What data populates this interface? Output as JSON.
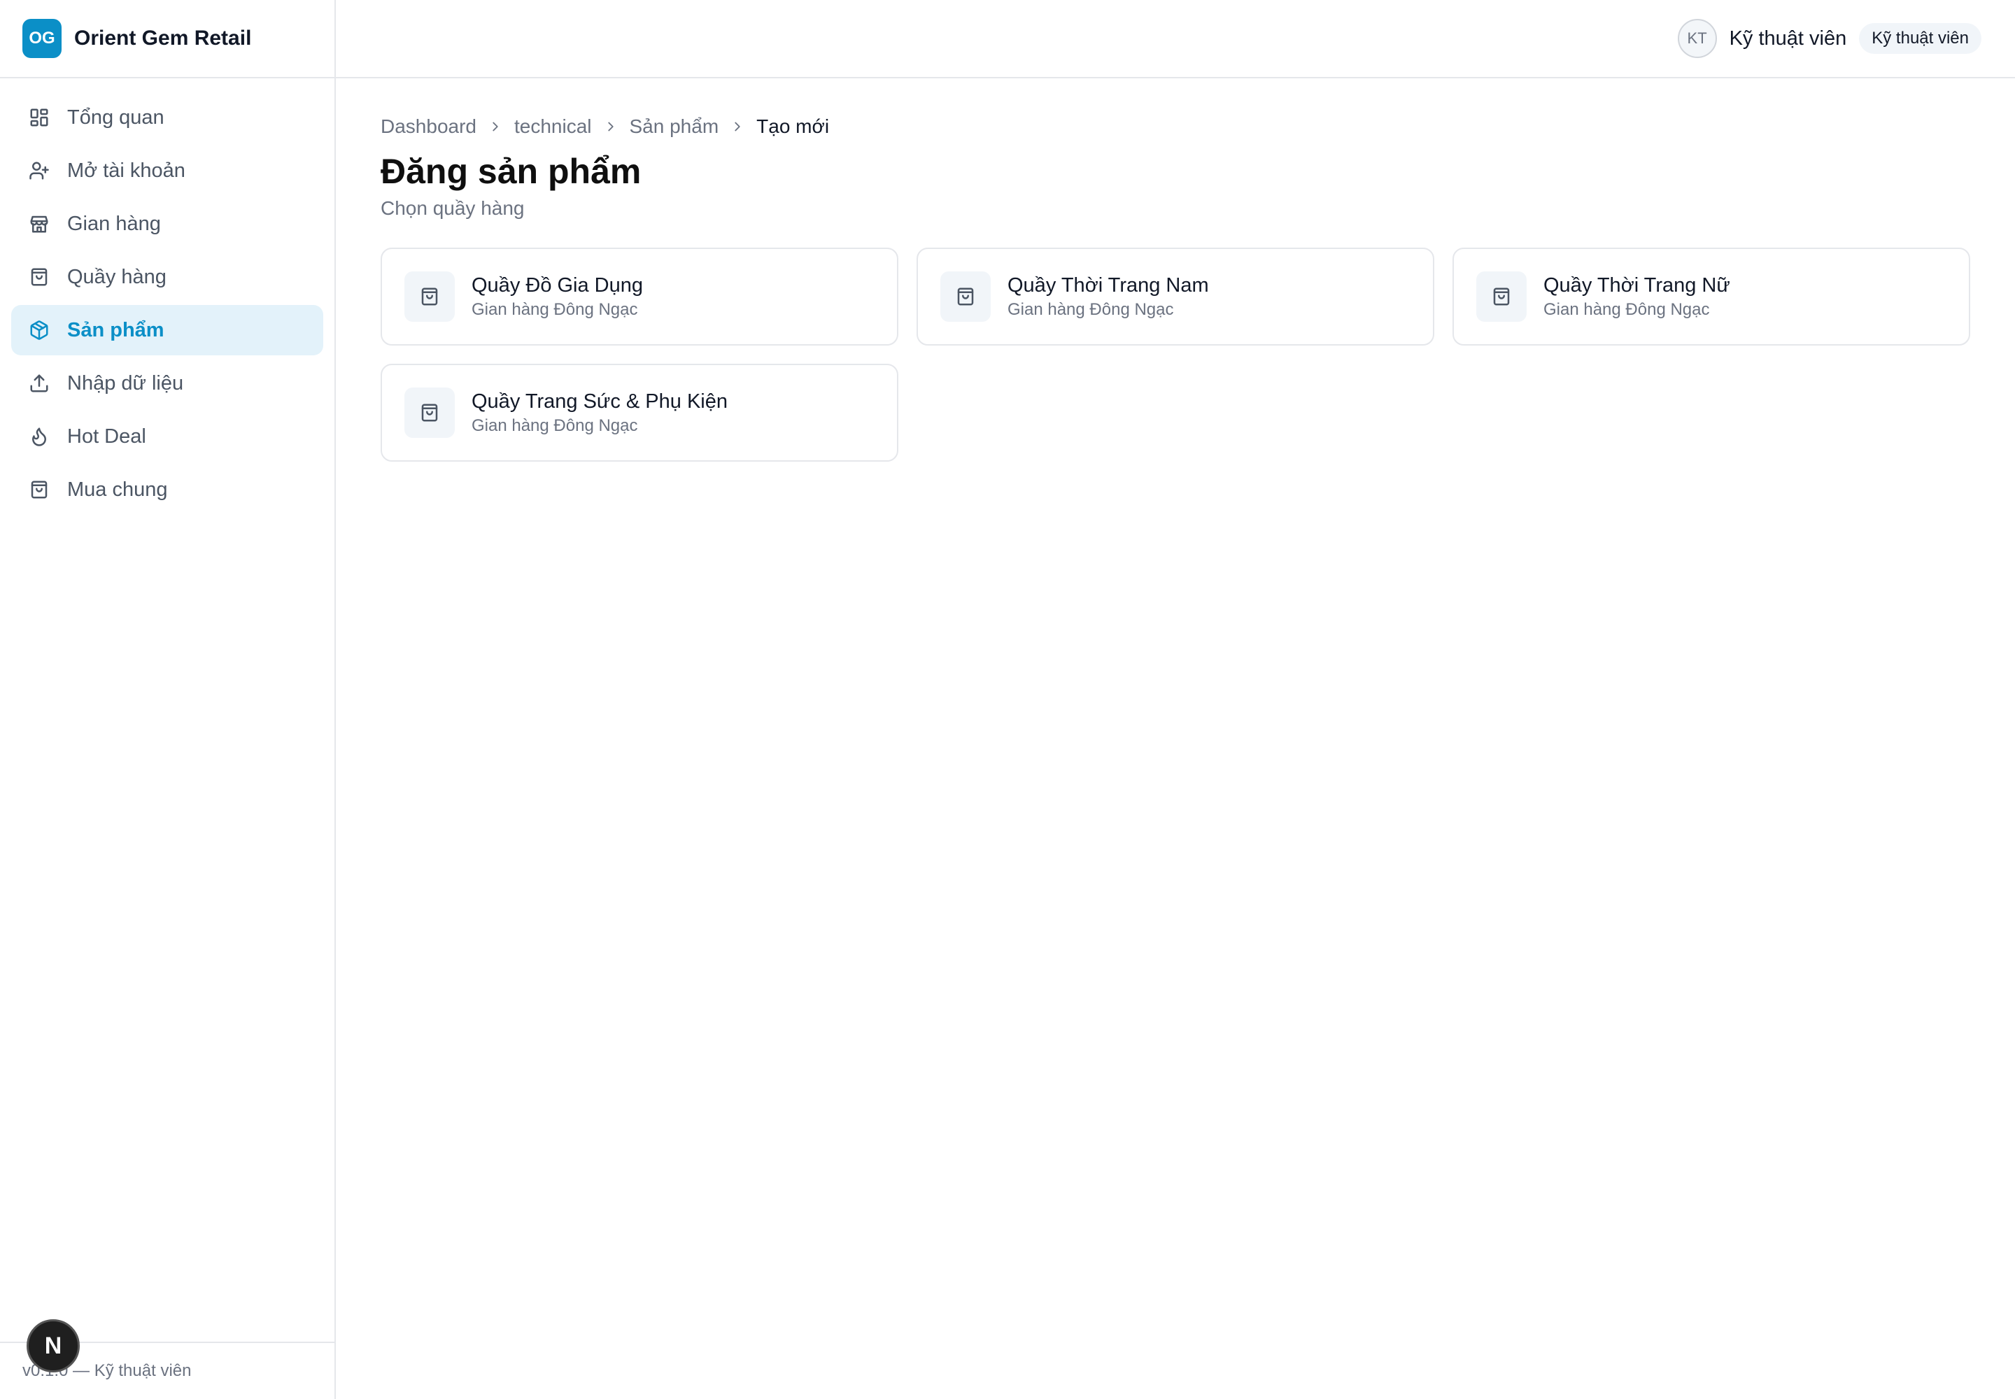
{
  "brand": {
    "logo": "OG",
    "name": "Orient Gem Retail"
  },
  "sidebar": {
    "items": [
      {
        "label": "Tổng quan",
        "icon": "dashboard-icon",
        "active": false
      },
      {
        "label": "Mở tài khoản",
        "icon": "user-plus-icon",
        "active": false
      },
      {
        "label": "Gian hàng",
        "icon": "store-icon",
        "active": false
      },
      {
        "label": "Quầy hàng",
        "icon": "shopping-bag-icon",
        "active": false
      },
      {
        "label": "Sản phẩm",
        "icon": "package-icon",
        "active": true
      },
      {
        "label": "Nhập dữ liệu",
        "icon": "upload-icon",
        "active": false
      },
      {
        "label": "Hot Deal",
        "icon": "flame-icon",
        "active": false
      },
      {
        "label": "Mua chung",
        "icon": "shopping-bag-icon",
        "active": false
      }
    ],
    "footer": "v0.1.0 — Kỹ thuật viên",
    "dev_badge": "N"
  },
  "header": {
    "avatar_initials": "KT",
    "user_name": "Kỹ thuật viên",
    "role_badge": "Kỹ thuật viên"
  },
  "breadcrumb": [
    "Dashboard",
    "technical",
    "Sản phẩm",
    "Tạo mới"
  ],
  "page": {
    "title": "Đăng sản phẩm",
    "subtitle": "Chọn quầy hàng"
  },
  "counters": [
    {
      "name": "Quầy Đồ Gia Dụng",
      "store": "Gian hàng Đông Ngạc"
    },
    {
      "name": "Quầy Thời Trang Nam",
      "store": "Gian hàng Đông Ngạc"
    },
    {
      "name": "Quầy Thời Trang Nữ",
      "store": "Gian hàng Đông Ngạc"
    },
    {
      "name": "Quầy Trang Sức & Phụ Kiện",
      "store": "Gian hàng Đông Ngạc"
    }
  ],
  "colors": {
    "accent": "#0b8fc7",
    "active_bg": "#e3f2fa",
    "border": "#e5e7eb"
  }
}
